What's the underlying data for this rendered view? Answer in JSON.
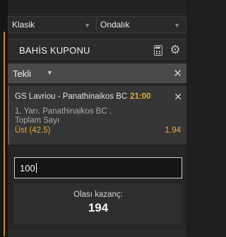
{
  "selects": {
    "odds_format_left": "Klasik",
    "odds_format_right": "Ondalık"
  },
  "coupon": {
    "title": "BAHİS KUPONU",
    "icons": [
      "calculator-icon",
      "gear-icon"
    ]
  },
  "bet_type": {
    "label": "Tekli"
  },
  "bet": {
    "match": "GS Lavriou - Panathinaikos BC",
    "time": "21:00",
    "market_line1": "1. Yarı. Panathinaikos BC .",
    "market_line2": "Toplam Sayı",
    "selection": "Üst (42.5)",
    "odds": "1.94"
  },
  "stake": {
    "value": "100"
  },
  "payout": {
    "label": "Olası kazanç:",
    "value": "194"
  }
}
